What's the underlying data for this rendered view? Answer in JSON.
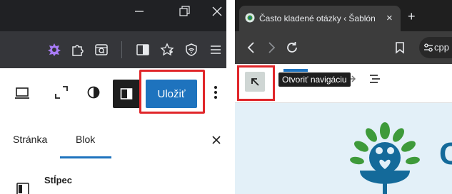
{
  "left_window": {
    "editor_toolbar": {
      "save_label": "Uložiť"
    },
    "sidebar_tabs": [
      {
        "label": "Stránka"
      },
      {
        "label": "Blok"
      }
    ],
    "block": {
      "title": "Stĺpec"
    }
  },
  "right_window": {
    "tab": {
      "title": "Často kladené otázky ‹ Šablóna ‹",
      "close_glyph": "×",
      "new_tab_glyph": "+"
    },
    "address": {
      "url_fragment": "cpp"
    },
    "editor": {
      "tooltip": "Otvoriť navigáciu",
      "logo_letter": "C"
    }
  },
  "colors": {
    "accent_blue": "#1e73be",
    "highlight_red": "#e0262a",
    "dark_chrome": "#202124",
    "canvas_bg": "#e3f0f8",
    "logo_teal": "#146a9a",
    "logo_green": "#3e9a3a"
  }
}
